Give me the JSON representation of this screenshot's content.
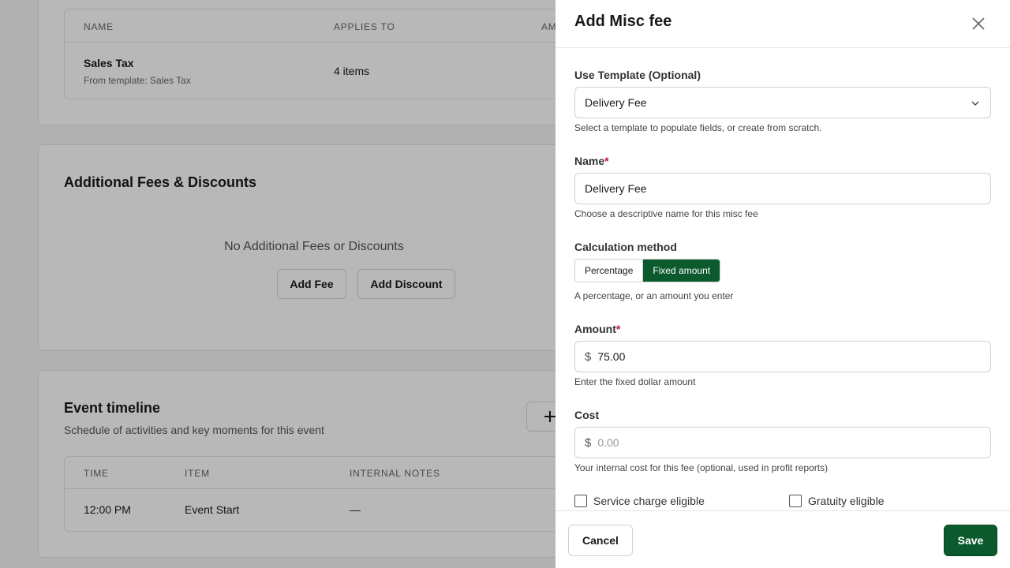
{
  "background": {
    "tax_table": {
      "headers": [
        "NAME",
        "APPLIES TO",
        "AM"
      ],
      "row": {
        "name": "Sales Tax",
        "source": "From template: Sales Tax",
        "applies_to": "4 items"
      }
    },
    "fees_section": {
      "title": "Additional Fees & Discounts",
      "empty_text": "No Additional Fees or Discounts",
      "add_fee_label": "Add Fee",
      "add_discount_label": "Add Discount"
    },
    "timeline_section": {
      "title": "Event timeline",
      "subtitle": "Schedule of activities and key moments for this event",
      "add_icon": "plus-icon",
      "headers": [
        "TIME",
        "ITEM",
        "INTERNAL NOTES"
      ],
      "row": {
        "time": "12:00 PM",
        "item": "Event Start",
        "notes": "—"
      }
    }
  },
  "drawer": {
    "title": "Add Misc fee",
    "close_icon": "close-icon",
    "template": {
      "label": "Use Template (Optional)",
      "value": "Delivery Fee",
      "help": "Select a template to populate fields, or create from scratch."
    },
    "name": {
      "label": "Name",
      "required_mark": "*",
      "value": "Delivery Fee",
      "help": "Choose a descriptive name for this misc fee"
    },
    "calculation": {
      "label": "Calculation method",
      "options": [
        "Percentage",
        "Fixed amount"
      ],
      "selected": "Fixed amount",
      "help": "A percentage, or an amount you enter"
    },
    "amount": {
      "label": "Amount",
      "required_mark": "*",
      "prefix": "$",
      "value": "75.00",
      "help": "Enter the fixed dollar amount"
    },
    "cost": {
      "label": "Cost",
      "prefix": "$",
      "placeholder": "0.00",
      "help": "Your internal cost for this fee (optional, used in profit reports)"
    },
    "checkboxes": {
      "service_charge": "Service charge eligible",
      "gratuity": "Gratuity eligible"
    },
    "footer": {
      "cancel_label": "Cancel",
      "save_label": "Save"
    }
  },
  "colors": {
    "accent": "#0b5a2e",
    "required": "#c8102e"
  }
}
